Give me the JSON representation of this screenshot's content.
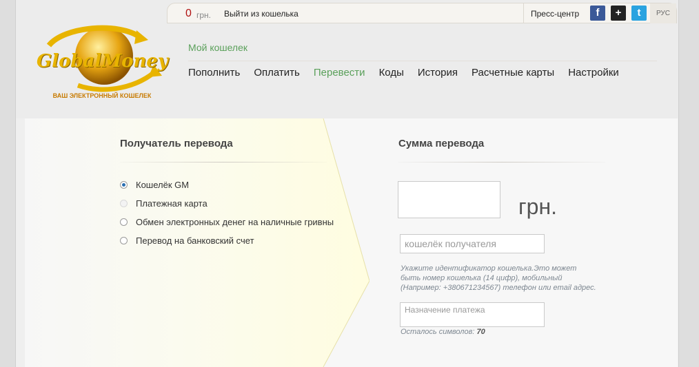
{
  "topbar": {
    "balance_value": "0",
    "balance_currency": "грн.",
    "logout_label": "Выйти из кошелька",
    "press_center_label": "Пресс-центр",
    "social": {
      "facebook": "f",
      "plus": "+",
      "twitter": "t"
    },
    "language": "РУС"
  },
  "logo": {
    "brand": "GlobalMoney",
    "tagline": "ВАШ ЭЛЕКТРОННЫЙ КОШЕЛЕК"
  },
  "header": {
    "wallet_title": "Мой кошелек"
  },
  "nav": {
    "items": [
      {
        "label": "Пополнить"
      },
      {
        "label": "Оплатить"
      },
      {
        "label": "Перевести"
      },
      {
        "label": "Коды"
      },
      {
        "label": "История"
      },
      {
        "label": "Расчетные карты"
      },
      {
        "label": "Настройки"
      }
    ],
    "active": "Перевести"
  },
  "recipient": {
    "title": "Получатель перевода",
    "options": [
      {
        "label": "Кошелёк GM",
        "checked": true,
        "disabled": false
      },
      {
        "label": "Платежная карта",
        "checked": false,
        "disabled": true
      },
      {
        "label": "Обмен электронных денег на наличные гривны",
        "checked": false,
        "disabled": false
      },
      {
        "label": "Перевод на банковский счет",
        "checked": false,
        "disabled": false
      }
    ]
  },
  "amount": {
    "title": "Сумма перевода",
    "amount_value": "",
    "currency": "грн.",
    "wallet_placeholder": "кошелёк получателя",
    "hint_line1": "Укажите идентификатор кошелька.Это может",
    "hint_line2": "быть номер кошелька (14 цифр), мобильный",
    "hint_line3": "(Например: +380671234567) телефон или email адрес.",
    "purpose_placeholder": "Назначение платежа",
    "counter_label": "Осталось символов:",
    "counter_value": "70"
  },
  "colors": {
    "accent_green": "#5aa05a",
    "balance_red": "#b01010",
    "panel_yellow": "#fffde0"
  }
}
